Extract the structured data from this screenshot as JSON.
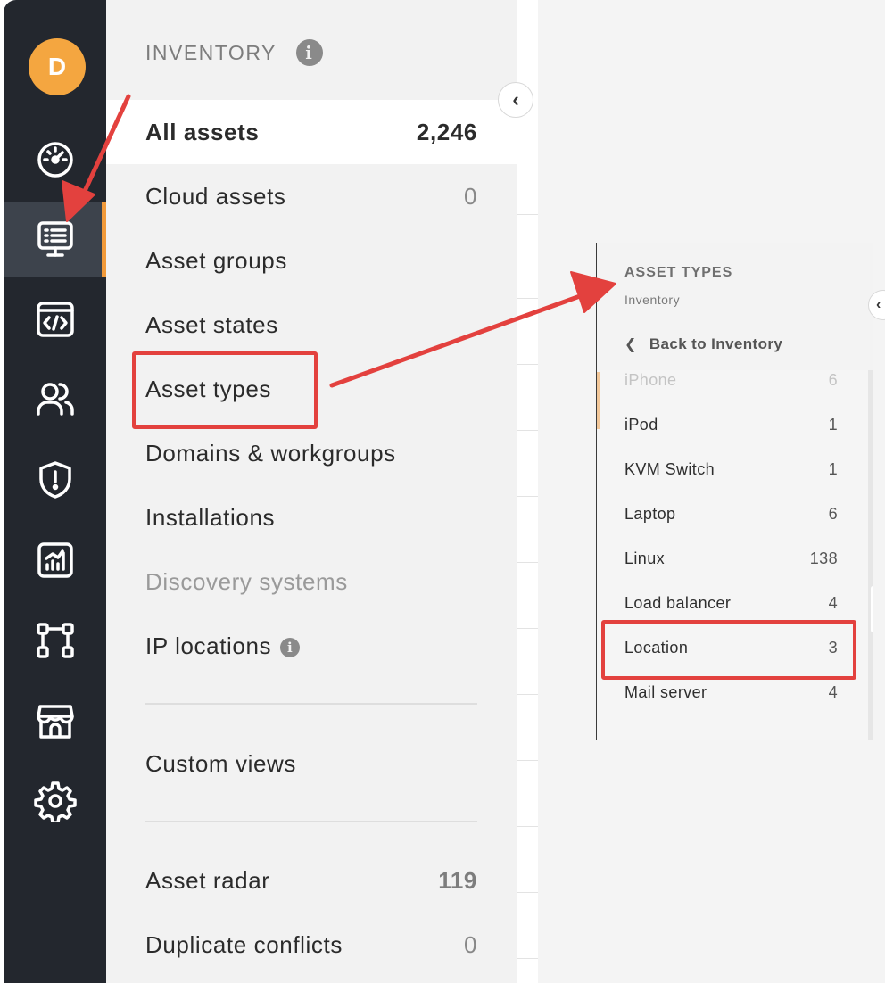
{
  "user": {
    "initial": "D",
    "avatar_color": "#f4a640"
  },
  "rail": {
    "items": [
      {
        "name": "dashboard",
        "icon": "speedometer-icon",
        "active": false
      },
      {
        "name": "inventory",
        "icon": "monitor-list-icon",
        "active": true
      },
      {
        "name": "code",
        "icon": "code-window-icon",
        "active": false
      },
      {
        "name": "users",
        "icon": "users-icon",
        "active": false
      },
      {
        "name": "security",
        "icon": "shield-alert-icon",
        "active": false
      },
      {
        "name": "reports",
        "icon": "chart-icon",
        "active": false
      },
      {
        "name": "workflows",
        "icon": "flow-icon",
        "active": false
      },
      {
        "name": "store",
        "icon": "store-icon",
        "active": false
      },
      {
        "name": "settings",
        "icon": "gear-icon",
        "active": false
      }
    ],
    "active_color": "#f29a3a"
  },
  "menu": {
    "header": "INVENTORY",
    "items": [
      {
        "label": "All assets",
        "count": "2,246"
      },
      {
        "label": "Cloud assets",
        "count": "0"
      },
      {
        "label": "Asset groups",
        "count": ""
      },
      {
        "label": "Asset states",
        "count": ""
      },
      {
        "label": "Asset types",
        "count": ""
      },
      {
        "label": "Domains & workgroups",
        "count": ""
      },
      {
        "label": "Installations",
        "count": ""
      },
      {
        "label": "Discovery systems",
        "count": ""
      },
      {
        "label": "IP locations",
        "count": ""
      }
    ],
    "custom_views": "Custom views",
    "asset_radar": {
      "label": "Asset radar",
      "count": "119"
    },
    "duplicate_conflicts": {
      "label": "Duplicate conflicts",
      "count": "0"
    }
  },
  "asset_types_panel": {
    "title": "ASSET TYPES",
    "subtitle": "Inventory",
    "back_label": "Back to Inventory",
    "rows": [
      {
        "label": "iPhone",
        "count": "6"
      },
      {
        "label": "iPod",
        "count": "1"
      },
      {
        "label": "KVM Switch",
        "count": "1"
      },
      {
        "label": "Laptop",
        "count": "6"
      },
      {
        "label": "Linux",
        "count": "138"
      },
      {
        "label": "Load balancer",
        "count": "4"
      },
      {
        "label": "Location",
        "count": "3"
      },
      {
        "label": "Mail server",
        "count": "4"
      }
    ]
  },
  "annotation_color": "#e3413e"
}
